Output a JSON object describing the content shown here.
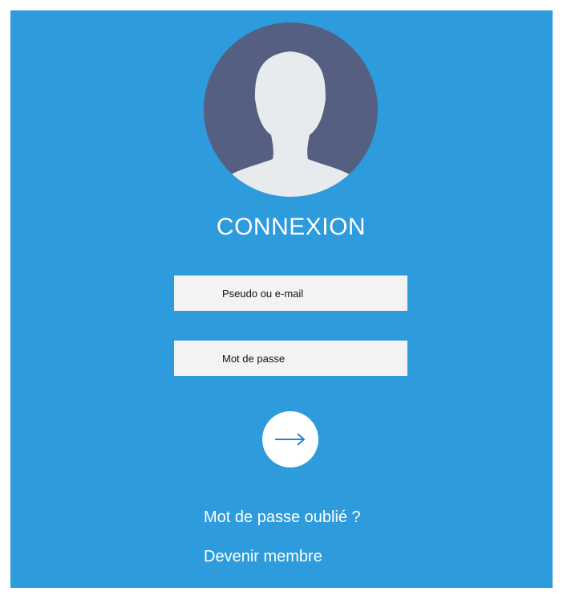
{
  "login": {
    "title": "CONNEXION",
    "username_placeholder": "Pseudo ou e-mail",
    "password_placeholder": "Mot de passe",
    "submit_icon": "arrow-right-icon",
    "avatar_icon": "user-silhouette-icon"
  },
  "links": {
    "forgot_password": "Mot de passe oublié ?",
    "register": "Devenir membre"
  },
  "colors": {
    "background": "#2e9bdc",
    "avatar_background": "#545f82",
    "avatar_figure": "#e8ebee",
    "field_background": "#f3f3f3",
    "arrow": "#2f7fd8"
  }
}
